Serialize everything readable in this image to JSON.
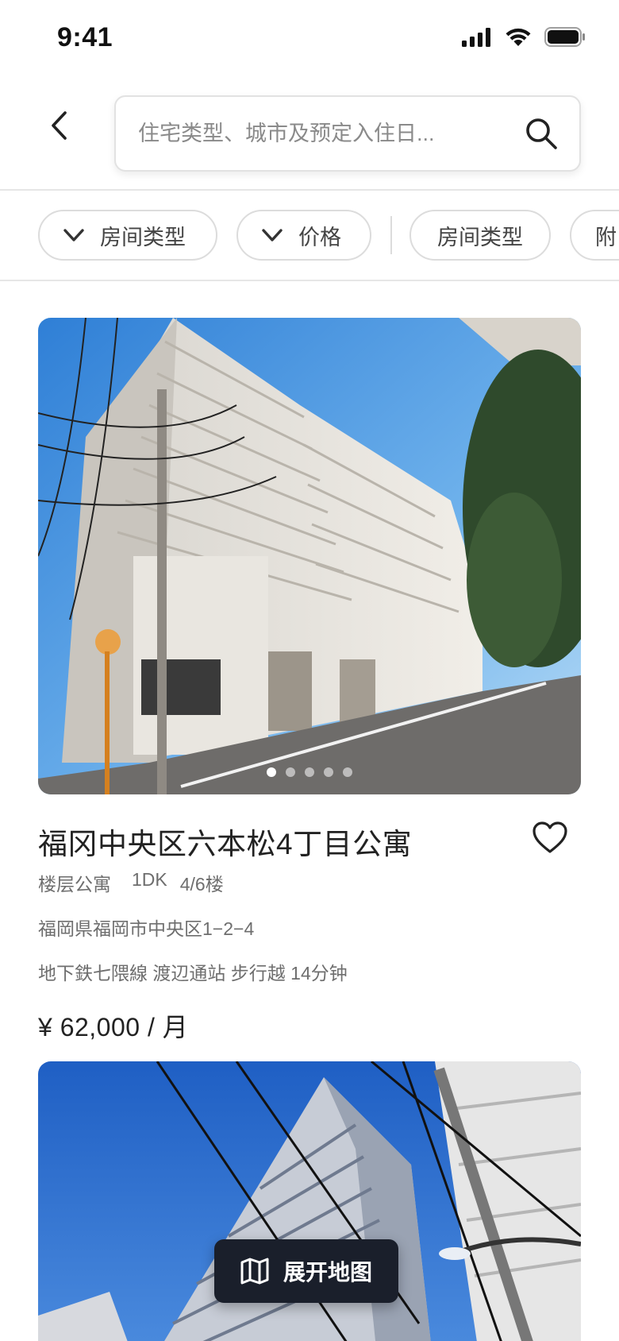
{
  "status_bar": {
    "time": "9:41"
  },
  "search": {
    "placeholder": "住宅类型、城市及预定入住日..."
  },
  "filters": [
    {
      "label": "房间类型",
      "has_dropdown": true
    },
    {
      "label": "价格",
      "has_dropdown": true
    },
    {
      "label": "房间类型",
      "has_dropdown": false
    },
    {
      "label": "附",
      "has_dropdown": false
    }
  ],
  "listings": [
    {
      "title": "福冈中央区六本松4丁目公寓",
      "type": "楼层公寓",
      "layout": "1DK",
      "floor": "4/6楼",
      "address": "福岡県福岡市中央区1−2−4",
      "transit": "地下鉄七隈線 渡辺通站 步行越 14分钟",
      "price": "¥ 62,000 / 月",
      "photo_count": 5,
      "active_photo": 1,
      "favorited": false
    }
  ],
  "map_button": {
    "label": "展开地图"
  },
  "colors": {
    "primary_dark": "#1a1f2b",
    "text": "#222222",
    "muted": "#6e6e6e",
    "border": "#dcdcdc"
  }
}
